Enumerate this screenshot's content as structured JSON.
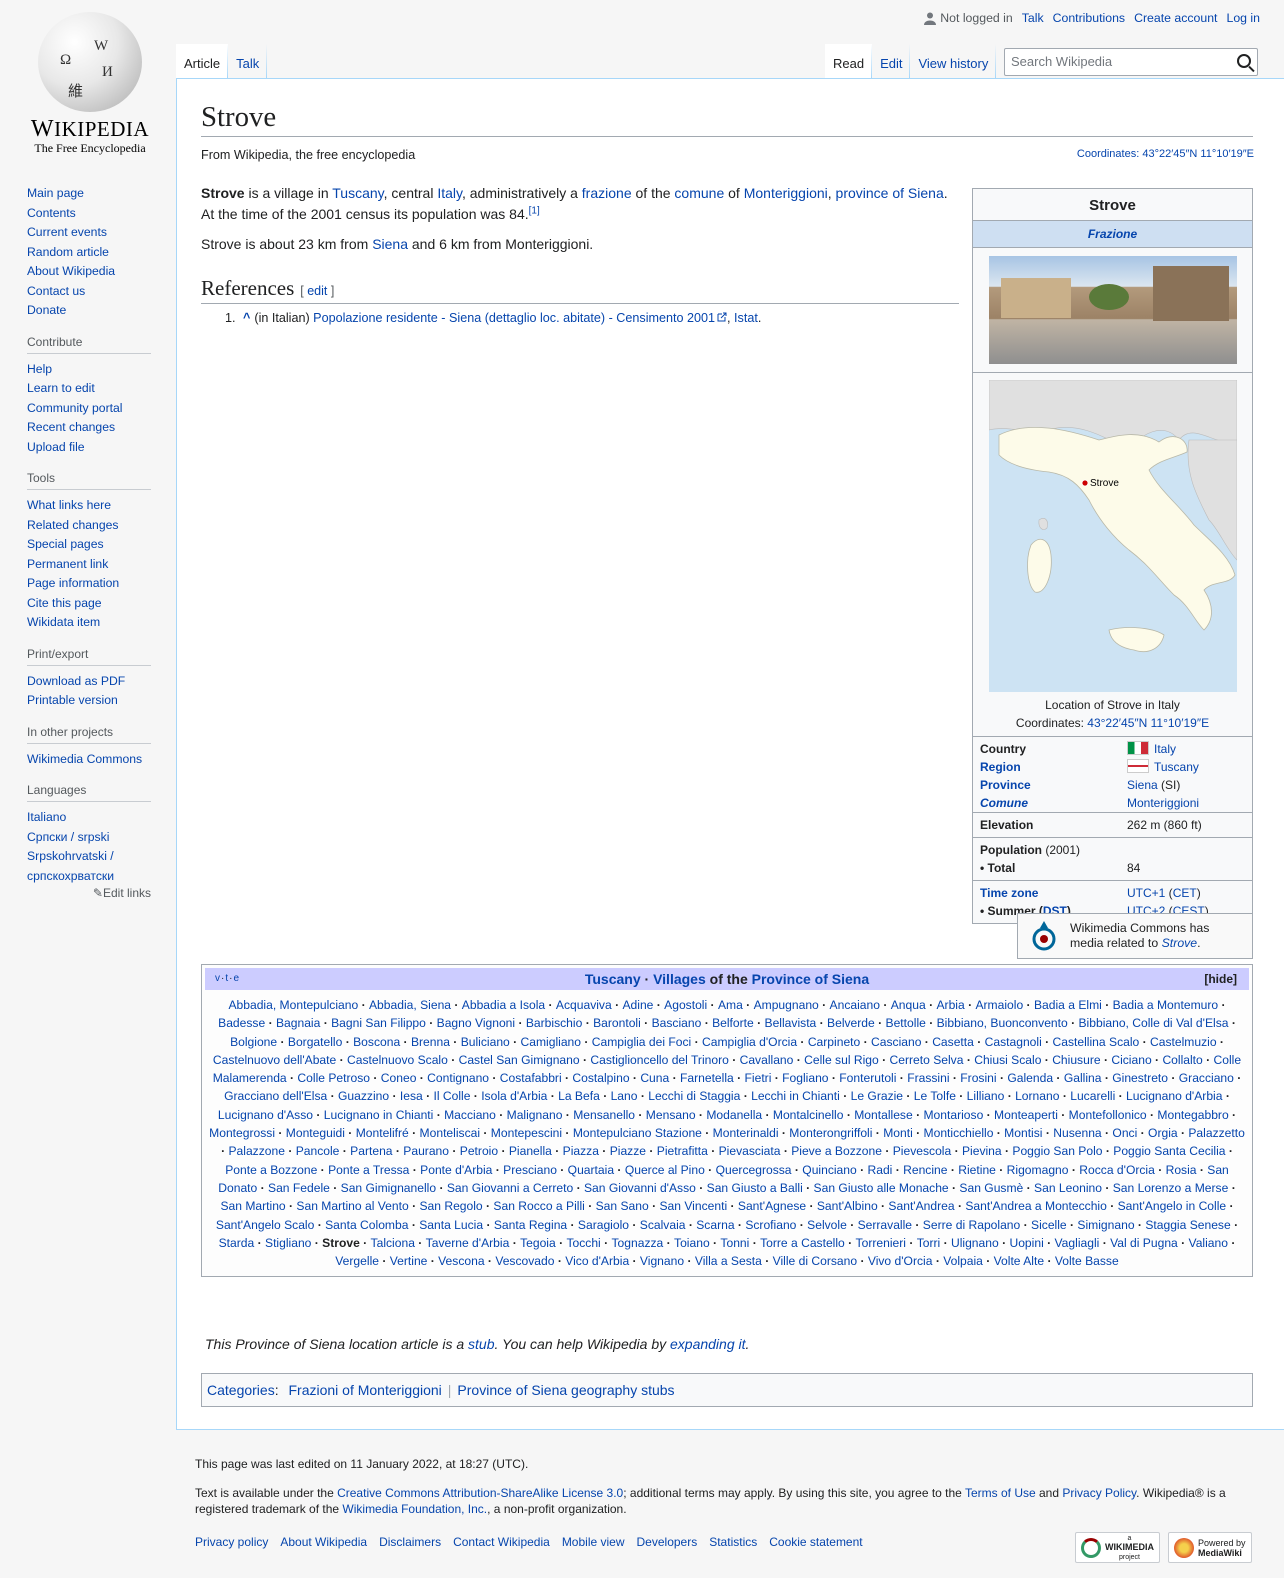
{
  "logo": {
    "wordmark": "Wikipedia",
    "tagline": "The Free Encyclopedia",
    "globe_glyphs": [
      "Ω",
      "W",
      "И",
      "維"
    ]
  },
  "personal": {
    "not_logged_in": "Not logged in",
    "talk": "Talk",
    "contributions": "Contributions",
    "create_account": "Create account",
    "log_in": "Log in"
  },
  "tabs": {
    "article": "Article",
    "talk": "Talk",
    "read": "Read",
    "edit": "Edit",
    "view_history": "View history"
  },
  "search": {
    "placeholder": "Search Wikipedia"
  },
  "sidebar": {
    "navigation": [
      "Main page",
      "Contents",
      "Current events",
      "Random article",
      "About Wikipedia",
      "Contact us",
      "Donate"
    ],
    "contribute": {
      "heading": "Contribute",
      "items": [
        "Help",
        "Learn to edit",
        "Community portal",
        "Recent changes",
        "Upload file"
      ]
    },
    "tools": {
      "heading": "Tools",
      "items": [
        "What links here",
        "Related changes",
        "Special pages",
        "Permanent link",
        "Page information",
        "Cite this page",
        "Wikidata item"
      ]
    },
    "print": {
      "heading": "Print/export",
      "items": [
        "Download as PDF",
        "Printable version"
      ]
    },
    "projects": {
      "heading": "In other projects",
      "items": [
        "Wikimedia Commons"
      ]
    },
    "languages": {
      "heading": "Languages",
      "items": [
        "Italiano",
        "Српски / srpski",
        "Srpskohrvatski / српскохрватски"
      ],
      "edit_links": "Edit links"
    }
  },
  "page": {
    "title": "Strove",
    "site_sub": "From Wikipedia, the free encyclopedia",
    "coordinates_label": "Coordinates:",
    "coordinates": "43°22′45″N 11°10′19″E",
    "intro": {
      "bold": "Strove",
      "t1": " is a village in ",
      "l1": "Tuscany",
      "t2": ", central ",
      "l2": "Italy",
      "t3": ", administratively a ",
      "l3": "frazione",
      "t4": " of the ",
      "l4": "comune",
      "t5": " of ",
      "l5": "Monteriggioni",
      "t6": ", ",
      "l6": "province of Siena",
      "t7": ". At the time of the 2001 census its population was 84.",
      "ref": "[1]"
    },
    "para2": {
      "t1": "Strove is about 23 km from ",
      "l1": "Siena",
      "t2": " and 6 km from Monteriggioni."
    },
    "references_heading": "References",
    "edit_label": "edit",
    "reference": {
      "num": "1.",
      "caret": "^",
      "lang": "(in Italian) ",
      "link": "Popolazione residente - Siena (dettaglio loc. abitate) - Censimento 2001",
      "sep": ", ",
      "publisher": "Istat",
      "end": "."
    }
  },
  "infobox": {
    "title": "Strove",
    "subtitle": "Frazione",
    "map_label": "Strove",
    "caption": "Location of Strove in Italy",
    "coords_label": "Coordinates: ",
    "coords": "43°22′45″N 11°10′19″E",
    "country_label": "Country",
    "country": "Italy",
    "region_label": "Region",
    "region": "Tuscany",
    "province_label": "Province",
    "province": "Siena",
    "province_code": " (SI)",
    "comune_label": "Comune",
    "comune": "Monteriggioni",
    "elevation_label": "Elevation",
    "elevation": "262 m (860 ft)",
    "population_label": "Population",
    "population_year": " (2001)",
    "total_label": " • Total",
    "total": "84",
    "timezone_label": "Time zone",
    "timezone": "UTC+1",
    "timezone_abbr": "CET",
    "summer_label": " • Summer (",
    "summer_dst": "DST",
    "summer_close": ")",
    "summer": "UTC+2",
    "summer_abbr": "CEST"
  },
  "commons": {
    "text": "Wikimedia Commons has media related to ",
    "link": "Strove",
    "end": "."
  },
  "navbox": {
    "vte": [
      "v",
      "t",
      "e"
    ],
    "title_parts": [
      "Tuscany",
      " · ",
      "Villages",
      " of the ",
      "Province of Siena"
    ],
    "hide": "[hide]",
    "current": "Strove",
    "villages": [
      "Abbadia, Montepulciano",
      "Abbadia, Siena",
      "Abbadia a Isola",
      "Acquaviva",
      "Adine",
      "Agostoli",
      "Ama",
      "Ampugnano",
      "Ancaiano",
      "Anqua",
      "Arbia",
      "Armaiolo",
      "Badia a Elmi",
      "Badia a Montemuro",
      "Badesse",
      "Bagnaia",
      "Bagni San Filippo",
      "Bagno Vignoni",
      "Barbischio",
      "Barontoli",
      "Basciano",
      "Belforte",
      "Bellavista",
      "Belverde",
      "Bettolle",
      "Bibbiano, Buonconvento",
      "Bibbiano, Colle di Val d'Elsa",
      "Bolgione",
      "Borgatello",
      "Boscona",
      "Brenna",
      "Buliciano",
      "Camigliano",
      "Campiglia dei Foci",
      "Campiglia d'Orcia",
      "Carpineto",
      "Casciano",
      "Casetta",
      "Castagnoli",
      "Castellina Scalo",
      "Castelmuzio",
      "Castelnuovo dell'Abate",
      "Castelnuovo Scalo",
      "Castel San Gimignano",
      "Castiglioncello del Trinoro",
      "Cavallano",
      "Celle sul Rigo",
      "Cerreto Selva",
      "Chiusi Scalo",
      "Chiusure",
      "Ciciano",
      "Collalto",
      "Colle Malamerenda",
      "Colle Petroso",
      "Coneo",
      "Contignano",
      "Costafabbri",
      "Costalpino",
      "Cuna",
      "Farnetella",
      "Fietri",
      "Fogliano",
      "Fonterutoli",
      "Frassini",
      "Frosini",
      "Galenda",
      "Gallina",
      "Ginestreto",
      "Gracciano",
      "Gracciano dell'Elsa",
      "Guazzino",
      "Iesa",
      "Il Colle",
      "Isola d'Arbia",
      "La Befa",
      "Lano",
      "Lecchi di Staggia",
      "Lecchi in Chianti",
      "Le Grazie",
      "Le Tolfe",
      "Lilliano",
      "Lornano",
      "Lucarelli",
      "Lucignano d'Arbia",
      "Lucignano d'Asso",
      "Lucignano in Chianti",
      "Macciano",
      "Malignano",
      "Mensanello",
      "Mensano",
      "Modanella",
      "Montalcinello",
      "Montallese",
      "Montarioso",
      "Monteaperti",
      "Montefollonico",
      "Montegabbro",
      "Montegrossi",
      "Monteguidi",
      "Montelifré",
      "Monteliscai",
      "Montepescini",
      "Montepulciano Stazione",
      "Monterinaldi",
      "Monterongriffoli",
      "Monti",
      "Monticchiello",
      "Montisi",
      "Nusenna",
      "Onci",
      "Orgia",
      "Palazzetto",
      "Palazzone",
      "Pancole",
      "Partena",
      "Paurano",
      "Petroio",
      "Pianella",
      "Piazza",
      "Piazze",
      "Pietrafitta",
      "Pievasciata",
      "Pieve a Bozzone",
      "Pievescola",
      "Pievina",
      "Poggio San Polo",
      "Poggio Santa Cecilia",
      "Ponte a Bozzone",
      "Ponte a Tressa",
      "Ponte d'Arbia",
      "Presciano",
      "Quartaia",
      "Querce al Pino",
      "Quercegrossa",
      "Quinciano",
      "Radi",
      "Rencine",
      "Rietine",
      "Rigomagno",
      "Rocca d'Orcia",
      "Rosia",
      "San Donato",
      "San Fedele",
      "San Gimignanello",
      "San Giovanni a Cerreto",
      "San Giovanni d'Asso",
      "San Giusto a Balli",
      "San Giusto alle Monache",
      "San Gusmè",
      "San Leonino",
      "San Lorenzo a Merse",
      "San Martino",
      "San Martino al Vento",
      "San Regolo",
      "San Rocco a Pilli",
      "San Sano",
      "San Vincenti",
      "Sant'Agnese",
      "Sant'Albino",
      "Sant'Andrea",
      "Sant'Andrea a Montecchio",
      "Sant'Angelo in Colle",
      "Sant'Angelo Scalo",
      "Santa Colomba",
      "Santa Lucia",
      "Santa Regina",
      "Saragiolo",
      "Scalvaia",
      "Scarna",
      "Scrofiano",
      "Selvole",
      "Serravalle",
      "Serre di Rapolano",
      "Sicelle",
      "Simignano",
      "Staggia Senese",
      "Starda",
      "Stigliano",
      "Strove",
      "Talciona",
      "Taverne d'Arbia",
      "Tegoia",
      "Tocchi",
      "Tognazza",
      "Toiano",
      "Tonni",
      "Torre a Castello",
      "Torrenieri",
      "Torri",
      "Ulignano",
      "Uopini",
      "Vagliagli",
      "Val di Pugna",
      "Valiano",
      "Vergelle",
      "Vertine",
      "Vescona",
      "Vescovado",
      "Vico d'Arbia",
      "Vignano",
      "Villa a Sesta",
      "Ville di Corsano",
      "Vivo d'Orcia",
      "Volpaia",
      "Volte Alte",
      "Volte Basse"
    ]
  },
  "stub": {
    "t1": "This Province of Siena location article is a ",
    "l1": "stub",
    "t2": ". You can help Wikipedia by ",
    "l2": "expanding it",
    "t3": "."
  },
  "categories": {
    "label": "Categories",
    "items": [
      "Frazioni of Monteriggioni",
      "Province of Siena geography stubs"
    ]
  },
  "footer": {
    "last_edited": "This page was last edited on 11 January 2022, at 18:27 (UTC).",
    "lic_t1": "Text is available under the ",
    "lic_l1": "Creative Commons Attribution-ShareAlike License 3.0",
    "lic_t2": "; additional terms may apply. By using this site, you agree to the ",
    "lic_l2": "Terms of Use",
    "lic_t3": " and ",
    "lic_l3": "Privacy Policy",
    "lic_t4": ". Wikipedia® is a registered trademark of the ",
    "lic_l4": "Wikimedia Foundation, Inc.",
    "lic_t5": ", a non-profit organization.",
    "places": [
      "Privacy policy",
      "About Wikipedia",
      "Disclaimers",
      "Contact Wikipedia",
      "Mobile view",
      "Developers",
      "Statistics",
      "Cookie statement"
    ],
    "badge_wikimedia": "WIKIMEDIA",
    "badge_wikimedia_small": "a",
    "badge_wikimedia_sub": "project",
    "badge_mediawiki_small": "Powered by",
    "badge_mediawiki": "MediaWiki"
  },
  "colors": {
    "link": "#0645ad",
    "navbox_header": "#ccccff",
    "infobox_sub": "#cedff2",
    "sea": "#cde3f3",
    "land": "#fdfbe9",
    "marker": "#cc0000"
  },
  "icons": {
    "user": "user-icon",
    "search": "search-icon",
    "external": "external-link-icon",
    "pencil": "pencil-icon",
    "commons": "commons-logo-icon"
  }
}
